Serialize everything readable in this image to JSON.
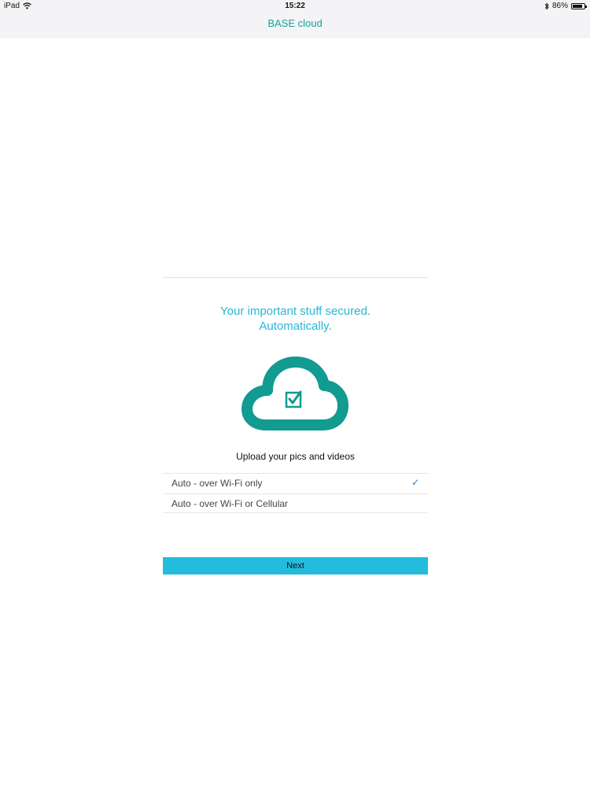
{
  "status_bar": {
    "device": "iPad",
    "time": "15:22",
    "battery": "86%",
    "battery_level": 0.86,
    "icons": [
      "wifi-icon",
      "bluetooth-icon",
      "battery-icon"
    ]
  },
  "nav": {
    "title": "BASE cloud"
  },
  "main": {
    "headline_line1": "Your important stuff secured.",
    "headline_line2": "Automatically.",
    "icon": "cloud-check-icon",
    "upload_label": "Upload your pics and videos",
    "options": [
      {
        "label": "Auto - over Wi-Fi only",
        "selected": true
      },
      {
        "label": "Auto - over Wi-Fi or Cellular",
        "selected": false
      }
    ],
    "next_label": "Next"
  },
  "colors": {
    "accent": "#13a59c",
    "headline": "#2bb6d4",
    "button": "#23bcdc",
    "check": "#1a7de0"
  }
}
